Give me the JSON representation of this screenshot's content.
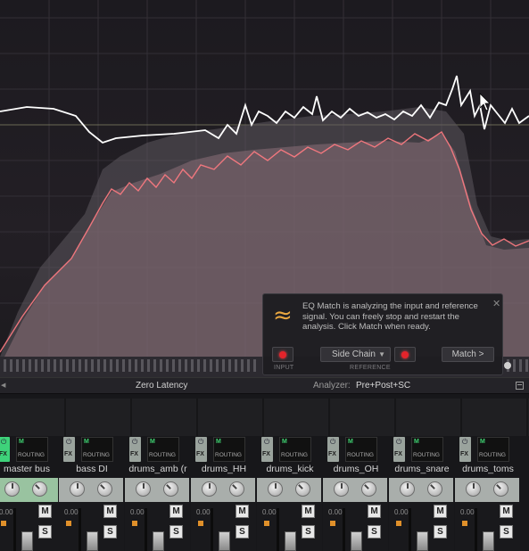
{
  "popup": {
    "icon": "≈",
    "message": "EQ Match is analyzing the input and reference signal. You can freely stop and restart the analysis. Click Match when ready.",
    "close": "✕",
    "input_label": "INPUT",
    "reference_label": "REFERENCE",
    "side_chain": "Side Chain",
    "match": "Match >"
  },
  "status": {
    "latency": "Zero Latency",
    "analyzer_label": "Analyzer:",
    "analyzer_value": "Pre+Post+SC"
  },
  "mixer": {
    "fx": "FX",
    "routing": "ROUTING",
    "m": "M",
    "s": "S",
    "tracks": [
      {
        "name": "master bus",
        "vol": "0.00"
      },
      {
        "name": "bass DI",
        "vol": "0.00"
      },
      {
        "name": "drums_amb (r",
        "vol": "0.00"
      },
      {
        "name": "drums_HH",
        "vol": "0.00"
      },
      {
        "name": "drums_kick",
        "vol": "0.00"
      },
      {
        "name": "drums_OH",
        "vol": "0.00"
      },
      {
        "name": "drums_snare",
        "vol": "0.00"
      },
      {
        "name": "drums_toms",
        "vol": "0.00"
      }
    ]
  },
  "colors": {
    "accent": "#e8a640",
    "record": "#e3242b",
    "input_curve": "#ff8a8a",
    "reference_curve": "#ffffff"
  }
}
